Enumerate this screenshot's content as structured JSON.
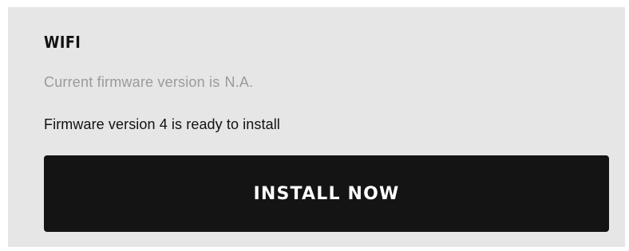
{
  "section": {
    "title": "WIFI"
  },
  "firmware": {
    "current_label": "Current firmware version is",
    "current_value": "N.A.",
    "ready_message": "Firmware version 4 is ready to install"
  },
  "actions": {
    "install_label": "INSTALL NOW"
  },
  "colors": {
    "panel_background": "#e6e6e6",
    "button_background": "#141414",
    "muted_text": "#9a9a9a",
    "primary_text": "#111111"
  }
}
